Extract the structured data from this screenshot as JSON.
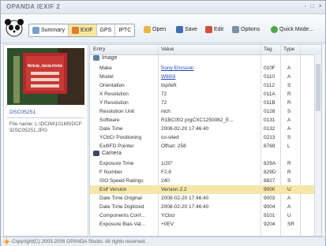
{
  "window": {
    "title": "OPANDA IEXIF 2",
    "controls": [
      "-",
      "□",
      "×"
    ]
  },
  "toolbar": {
    "tabs": [
      {
        "label": "Summary"
      },
      {
        "label": "EXIF"
      },
      {
        "label": "GPS"
      },
      {
        "label": "IPTC"
      }
    ],
    "active_tab": "EXIF",
    "buttons": [
      {
        "label": "Open"
      },
      {
        "label": "Save"
      },
      {
        "label": "Edit"
      },
      {
        "label": "Options"
      },
      {
        "label": "Quick Mode..."
      }
    ]
  },
  "file": {
    "name": "DSC05251",
    "info": "File name: L:\\DCIM\\101MSDCF\\DSC05251.JPG"
  },
  "photo": {
    "sign_text": "Mind the step ... Stand clear of the Doors"
  },
  "table": {
    "columns": [
      "Entry",
      "Value",
      "Tag",
      "Type"
    ],
    "groups": [
      {
        "name": "Image",
        "rows": [
          {
            "entry": "Make",
            "value": "Sony Ericsson",
            "tag": "010F",
            "type": "A",
            "link": true
          },
          {
            "entry": "Model",
            "value": "W800i",
            "tag": "0110",
            "type": "A",
            "link": true
          },
          {
            "entry": "Orientation",
            "value": "top/left",
            "tag": "0112",
            "type": "S"
          },
          {
            "entry": "X Resolution",
            "value": "72",
            "tag": "011A",
            "type": "R"
          },
          {
            "entry": "Y Resolution",
            "value": "72",
            "tag": "011B",
            "type": "R"
          },
          {
            "entry": "Resolution Unit",
            "value": "inch",
            "tag": "0128",
            "type": "S"
          },
          {
            "entry": "Software",
            "value": "R1BC002   prgCXC1250082_E...",
            "tag": "0131",
            "type": "A"
          },
          {
            "entry": "Date Time",
            "value": "2008-02-20 17:46:40",
            "tag": "0132",
            "type": "A"
          },
          {
            "entry": "YCbCr Positioning",
            "value": "co-sited",
            "tag": "0213",
            "type": "S"
          },
          {
            "entry": "ExifIFD Pointer",
            "value": "Offset: 258",
            "tag": "8769",
            "type": "L"
          }
        ]
      },
      {
        "name": "Camera",
        "rows": [
          {
            "entry": "Exposure Time",
            "value": "1/20\"",
            "tag": "829A",
            "type": "R"
          },
          {
            "entry": "F Number",
            "value": "F2.8",
            "tag": "829D",
            "type": "R"
          },
          {
            "entry": "ISO Speed Ratings",
            "value": "240",
            "tag": "8827",
            "type": "S"
          },
          {
            "entry": "Exif Version",
            "value": "Version 2.2",
            "tag": "9000",
            "type": "U",
            "highlight": true
          },
          {
            "entry": "Date Time Original",
            "value": "2008-02-20 17:46:40",
            "tag": "9003",
            "type": "A"
          },
          {
            "entry": "Date Time Digitized",
            "value": "2008-02-20 17:46:40",
            "tag": "9004",
            "type": "A"
          },
          {
            "entry": "Components Conf...",
            "value": "YCbcr",
            "tag": "9101",
            "type": "U"
          },
          {
            "entry": "Exposure Bias Val...",
            "value": "+0EV",
            "tag": "9204",
            "type": "SR"
          }
        ]
      }
    ]
  },
  "status": {
    "text": "Copyright(C) 2003-2006 OPANDA Studio. All rights reserved."
  },
  "colors": {
    "accent": "#f6e6a8",
    "link": "#2244bb",
    "title": "#6f7f95"
  }
}
